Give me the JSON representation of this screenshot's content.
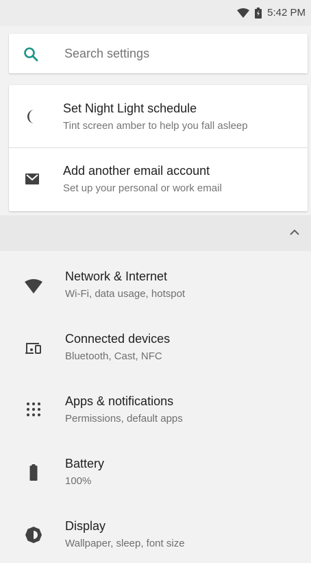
{
  "status_bar": {
    "time": "5:42 PM",
    "icons": [
      "wifi-icon",
      "battery-icon"
    ]
  },
  "search": {
    "placeholder": "Search settings",
    "icon": "search-icon",
    "accent": "#1a9688"
  },
  "suggestions": [
    {
      "icon": "moon-icon",
      "title": "Set Night Light schedule",
      "subtitle": "Tint screen amber to help you fall asleep"
    },
    {
      "icon": "email-icon",
      "title": "Add another email account",
      "subtitle": "Set up your personal or work email"
    }
  ],
  "collapse": {
    "icon": "chevron-up-icon"
  },
  "settings": [
    {
      "icon": "wifi-icon",
      "title": "Network & Internet",
      "subtitle": "Wi-Fi, data usage, hotspot"
    },
    {
      "icon": "devices-icon",
      "title": "Connected devices",
      "subtitle": "Bluetooth, Cast, NFC"
    },
    {
      "icon": "apps-grid-icon",
      "title": "Apps & notifications",
      "subtitle": "Permissions, default apps"
    },
    {
      "icon": "battery-icon",
      "title": "Battery",
      "subtitle": "100%"
    },
    {
      "icon": "brightness-icon",
      "title": "Display",
      "subtitle": "Wallpaper, sleep, font size"
    }
  ]
}
